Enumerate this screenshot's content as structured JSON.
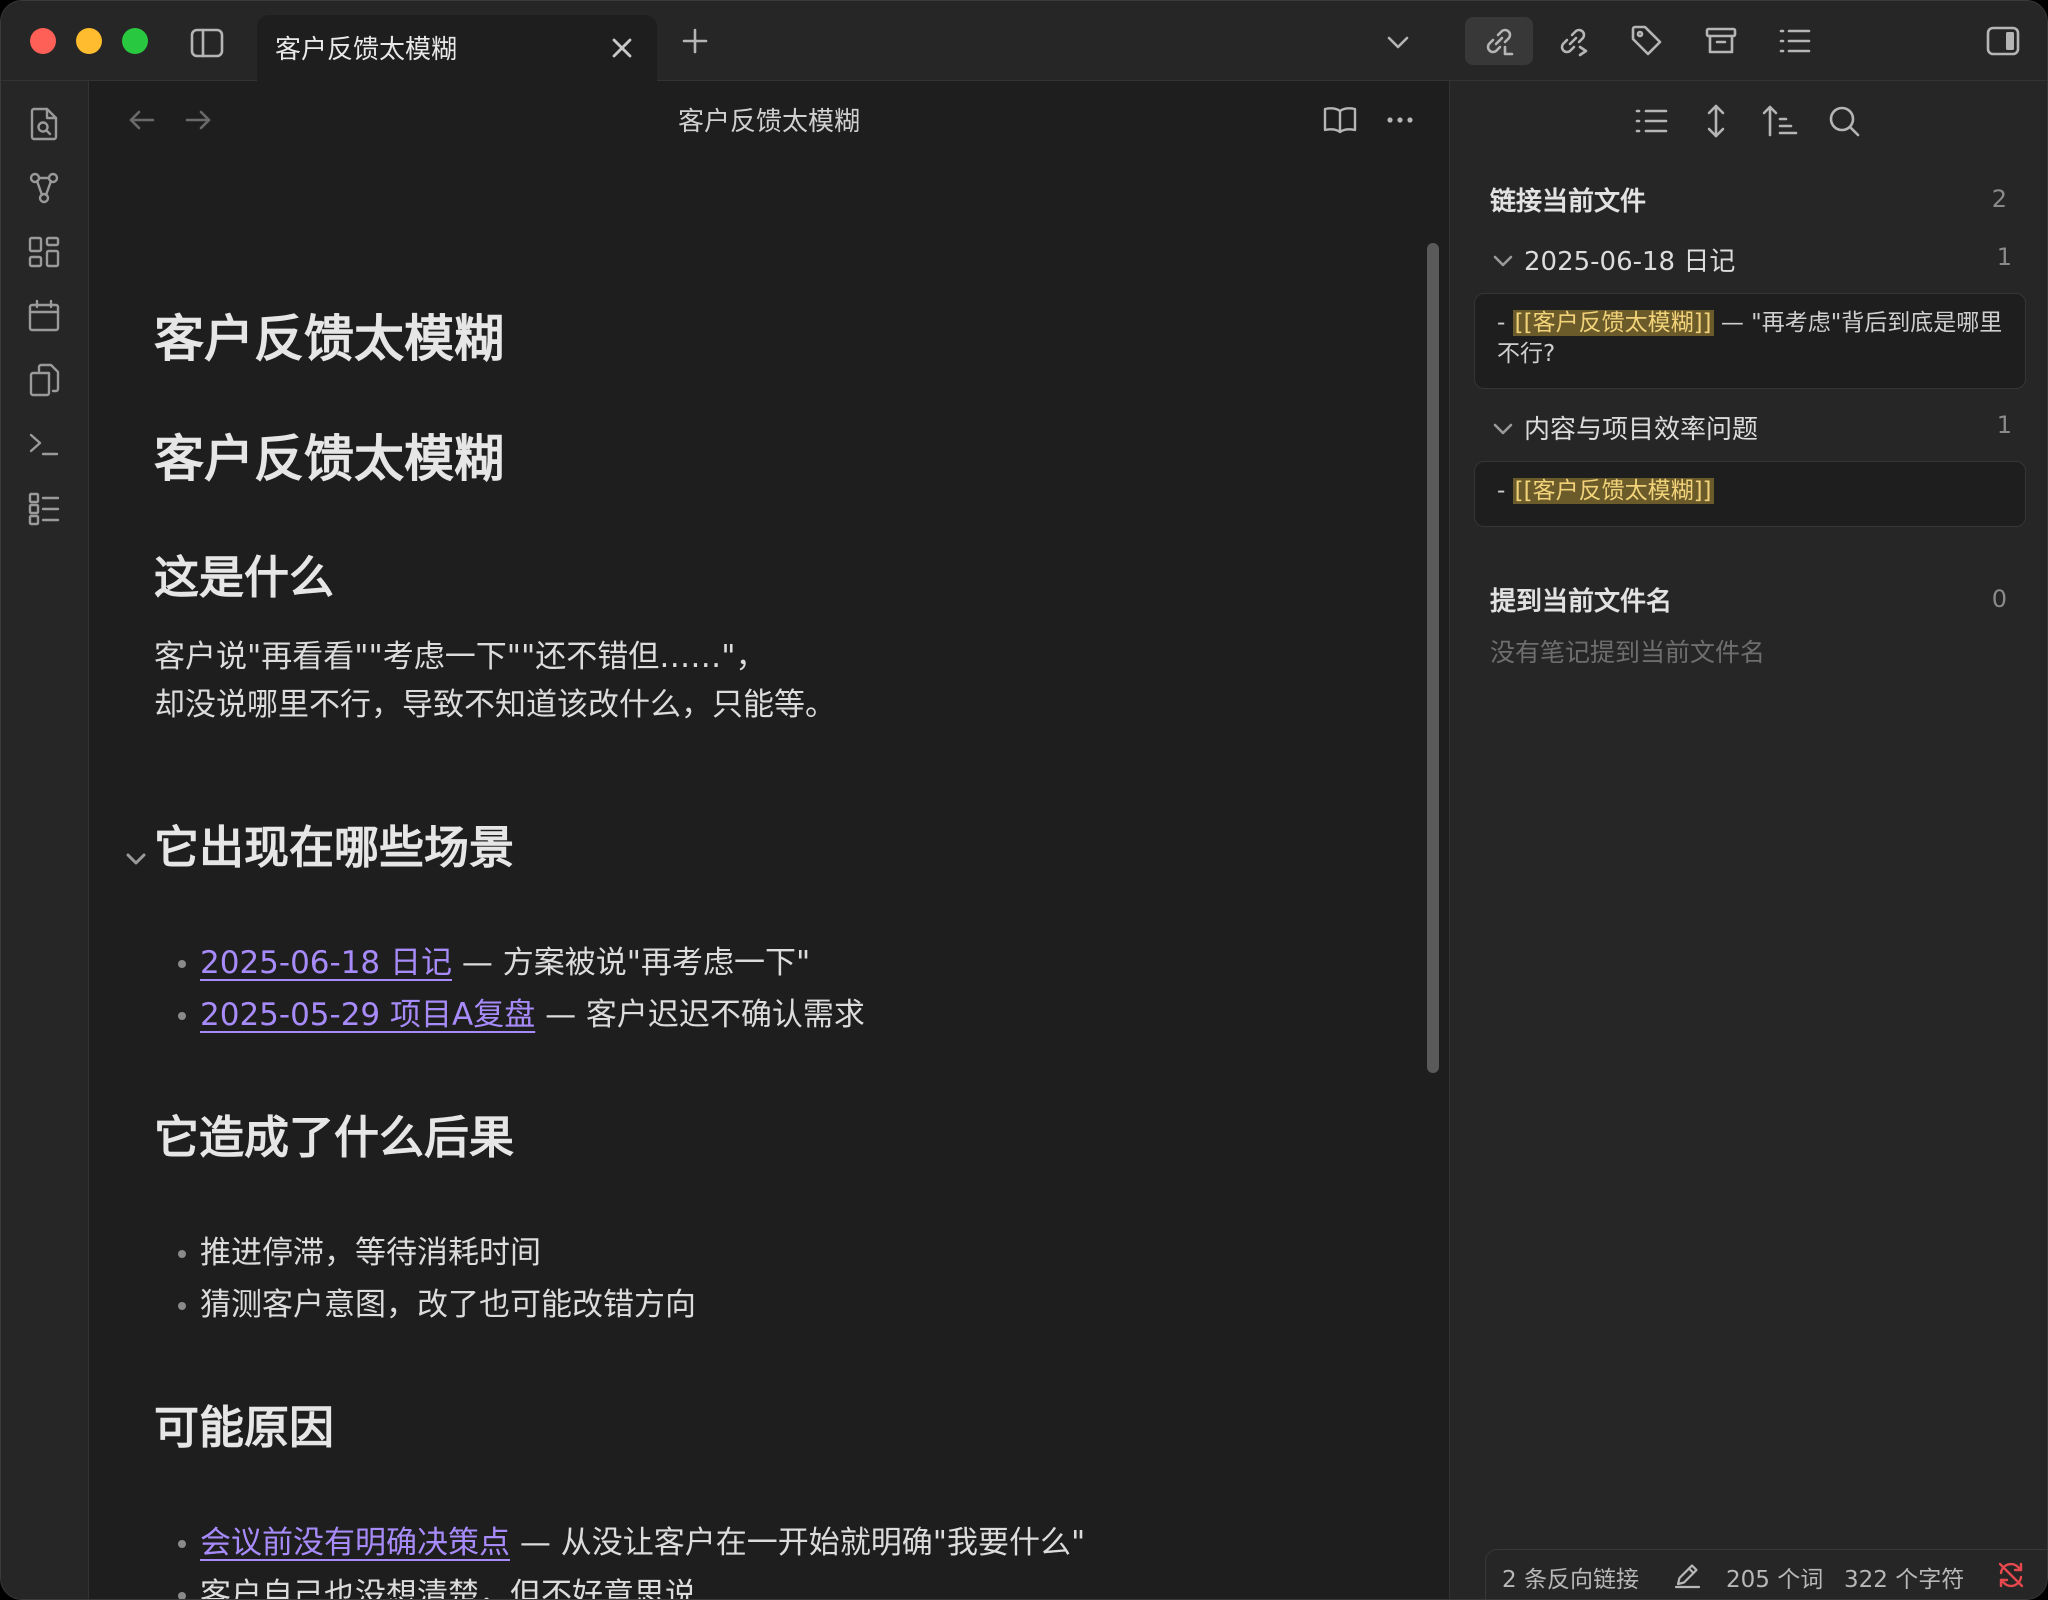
{
  "tab": {
    "title": "客户反馈太模糊"
  },
  "view": {
    "title": "客户反馈太模糊"
  },
  "note": {
    "title": "客户反馈太模糊",
    "heading_main": "客户反馈太模糊",
    "section_what": {
      "heading": "这是什么",
      "line1": "客户说\"再看看\"\"考虑一下\"\"还不错但……\"，",
      "line2": "却没说哪里不行，导致不知道该改什么，只能等。"
    },
    "section_scenes": {
      "heading": "它出现在哪些场景",
      "items": [
        {
          "link": "2025-06-18 日记",
          "text": " — 方案被说\"再考虑一下\""
        },
        {
          "link": "2025-05-29 项目A复盘",
          "text": " — 客户迟迟不确认需求"
        }
      ]
    },
    "section_consequences": {
      "heading": "它造成了什么后果",
      "items": [
        "推进停滞，等待消耗时间",
        "猜测客户意图，改了也可能改错方向"
      ]
    },
    "section_causes": {
      "heading": "可能原因",
      "item1_link": "会议前没有明确决策点",
      "item1_text": " — 从没让客户在一开始就明确\"我要什么\"",
      "item2": "客户自己也没想清楚，但不好意思说"
    }
  },
  "backlinks": {
    "linked_title": "链接当前文件",
    "linked_count": "2",
    "groups": [
      {
        "title": "2025-06-18 日记",
        "count": "1",
        "prefix": "- ",
        "highlight": "[[客户反馈太模糊]]",
        "suffix": " — \"再考虑\"背后到底是哪里不行?"
      },
      {
        "title": "内容与项目效率问题",
        "count": "1",
        "prefix": "- ",
        "highlight": "[[客户反馈太模糊]]",
        "suffix": ""
      }
    ],
    "unlinked_title": "提到当前文件名",
    "unlinked_count": "0",
    "unlinked_empty": "没有笔记提到当前文件名"
  },
  "status": {
    "backlinks": "2 条反向链接",
    "words": "205 个词",
    "chars": "322 个字符"
  },
  "colors": {
    "accent_link": "#a88bfa",
    "highlight_bg": "#6b5b2a",
    "sync_error": "#e5484d"
  }
}
